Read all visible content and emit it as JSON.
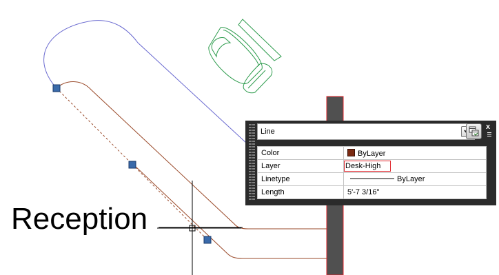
{
  "drawing": {
    "annotation_text": "Reception",
    "colors": {
      "background": "#ffffff",
      "path_blue": "#6a6ad0",
      "path_brown": "#9a4a2a",
      "chair_green": "#2a9a4a",
      "grip_blue": "#3a6aaa",
      "column_fill": "#505050",
      "column_outline": "#e0242b",
      "crosshair": "#000000"
    }
  },
  "quick_properties": {
    "object_type": "Line",
    "close_label": "x",
    "rows": [
      {
        "label": "Color",
        "value": "ByLayer",
        "swatch_color": "#7a2a12"
      },
      {
        "label": "Layer",
        "value": "Desk-High"
      },
      {
        "label": "Linetype",
        "value": "ByLayer"
      },
      {
        "label": "Length",
        "value": "5'-7 3/16\""
      }
    ]
  }
}
